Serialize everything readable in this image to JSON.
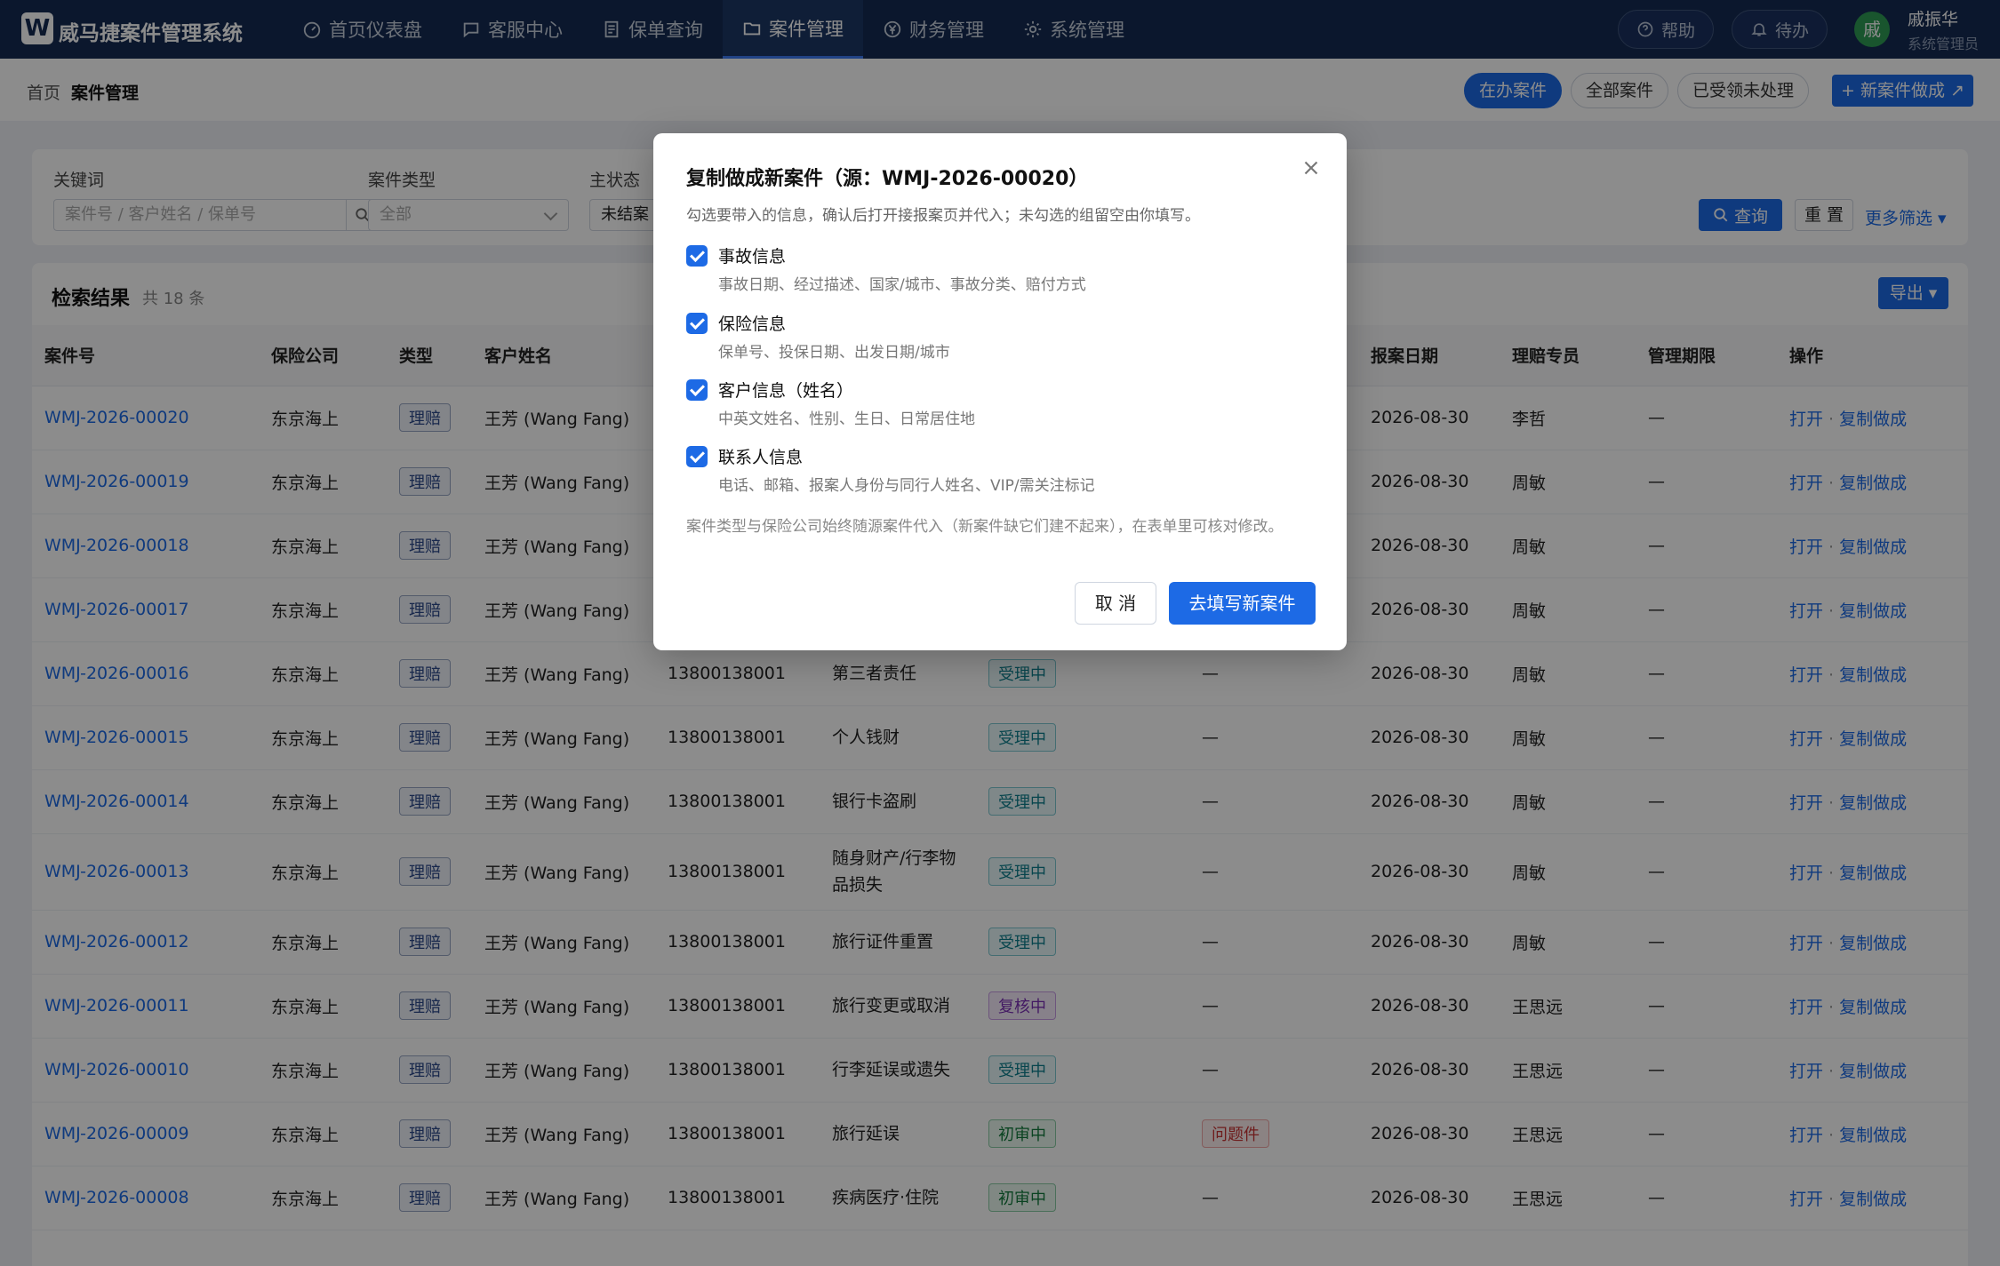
{
  "app": {
    "logo_letter": "W",
    "title": "威马捷案件管理系统"
  },
  "nav": [
    {
      "label": "首页仪表盘",
      "icon": "dashboard-icon"
    },
    {
      "label": "客服中心",
      "icon": "chat-icon"
    },
    {
      "label": "保单查询",
      "icon": "document-icon"
    },
    {
      "label": "案件管理",
      "icon": "folder-icon",
      "active": true
    },
    {
      "label": "财务管理",
      "icon": "yen-icon"
    },
    {
      "label": "系统管理",
      "icon": "gear-icon"
    }
  ],
  "top_right": {
    "help": "帮助",
    "todo": "待办",
    "avatar_char": "戚",
    "user_name": "戚振华",
    "user_role": "系统管理员"
  },
  "breadcrumb": {
    "home": "首页",
    "current": "案件管理"
  },
  "segments": [
    "在办案件",
    "全部案件",
    "已受领未处理"
  ],
  "new_case_label": "+ 新案件做成 ↗",
  "filter": {
    "keyword_label": "关键词",
    "keyword_placeholder": "案件号 / 客户姓名 / 保单号",
    "type_label": "案件类型",
    "type_value": "全部",
    "status_label": "主状态",
    "status_value": "未结案",
    "query": "查询",
    "reset": "重 置",
    "more": "更多筛选 ▾"
  },
  "results": {
    "title": "检索结果",
    "count": "共 18 条",
    "export": "导出 ▾",
    "columns": [
      "案件号",
      "保险公司",
      "类型",
      "客户姓名",
      "",
      "",
      "",
      "",
      "报案日期",
      "理赔专员",
      "管理期限",
      "操作"
    ],
    "op_open": "打开",
    "op_copy": "复制做成",
    "rows": [
      {
        "id": "WMJ-2026-00020",
        "company": "东京海上",
        "type": "理赔",
        "customer": "王芳 (Wang Fang)",
        "phone": "",
        "category": "",
        "status": "",
        "status_color": "",
        "issue": "",
        "date": "2026-08-30",
        "agent": "李哲",
        "deadline": "—"
      },
      {
        "id": "WMJ-2026-00019",
        "company": "东京海上",
        "type": "理赔",
        "customer": "王芳 (Wang Fang)",
        "phone": "",
        "category": "",
        "status": "",
        "status_color": "",
        "issue": "",
        "date": "2026-08-30",
        "agent": "周敏",
        "deadline": "—"
      },
      {
        "id": "WMJ-2026-00018",
        "company": "东京海上",
        "type": "理赔",
        "customer": "王芳 (Wang Fang)",
        "phone": "",
        "category": "",
        "status": "",
        "status_color": "",
        "issue": "",
        "date": "2026-08-30",
        "agent": "周敏",
        "deadline": "—"
      },
      {
        "id": "WMJ-2026-00017",
        "company": "东京海上",
        "type": "理赔",
        "customer": "王芳 (Wang Fang)",
        "phone": "",
        "category": "",
        "status": "",
        "status_color": "",
        "issue": "",
        "date": "2026-08-30",
        "agent": "周敏",
        "deadline": "—"
      },
      {
        "id": "WMJ-2026-00016",
        "company": "东京海上",
        "type": "理赔",
        "customer": "王芳 (Wang Fang)",
        "phone": "13800138001",
        "category": "第三者责任",
        "status": "受理中",
        "status_color": "cyan",
        "issue": "—",
        "date": "2026-08-30",
        "agent": "周敏",
        "deadline": "—"
      },
      {
        "id": "WMJ-2026-00015",
        "company": "东京海上",
        "type": "理赔",
        "customer": "王芳 (Wang Fang)",
        "phone": "13800138001",
        "category": "个人钱财",
        "status": "受理中",
        "status_color": "cyan",
        "issue": "—",
        "date": "2026-08-30",
        "agent": "周敏",
        "deadline": "—"
      },
      {
        "id": "WMJ-2026-00014",
        "company": "东京海上",
        "type": "理赔",
        "customer": "王芳 (Wang Fang)",
        "phone": "13800138001",
        "category": "银行卡盗刷",
        "status": "受理中",
        "status_color": "cyan",
        "issue": "—",
        "date": "2026-08-30",
        "agent": "周敏",
        "deadline": "—"
      },
      {
        "id": "WMJ-2026-00013",
        "company": "东京海上",
        "type": "理赔",
        "customer": "王芳 (Wang Fang)",
        "phone": "13800138001",
        "category": "随身财产/行李物品损失",
        "status": "受理中",
        "status_color": "cyan",
        "issue": "—",
        "date": "2026-08-30",
        "agent": "周敏",
        "deadline": "—"
      },
      {
        "id": "WMJ-2026-00012",
        "company": "东京海上",
        "type": "理赔",
        "customer": "王芳 (Wang Fang)",
        "phone": "13800138001",
        "category": "旅行证件重置",
        "status": "受理中",
        "status_color": "cyan",
        "issue": "—",
        "date": "2026-08-30",
        "agent": "周敏",
        "deadline": "—"
      },
      {
        "id": "WMJ-2026-00011",
        "company": "东京海上",
        "type": "理赔",
        "customer": "王芳 (Wang Fang)",
        "phone": "13800138001",
        "category": "旅行变更或取消",
        "status": "复核中",
        "status_color": "purple",
        "issue": "—",
        "date": "2026-08-30",
        "agent": "王思远",
        "deadline": "—"
      },
      {
        "id": "WMJ-2026-00010",
        "company": "东京海上",
        "type": "理赔",
        "customer": "王芳 (Wang Fang)",
        "phone": "13800138001",
        "category": "行李延误或遗失",
        "status": "受理中",
        "status_color": "cyan",
        "issue": "—",
        "date": "2026-08-30",
        "agent": "王思远",
        "deadline": "—"
      },
      {
        "id": "WMJ-2026-00009",
        "company": "东京海上",
        "type": "理赔",
        "customer": "王芳 (Wang Fang)",
        "phone": "13800138001",
        "category": "旅行延误",
        "status": "初审中",
        "status_color": "green",
        "issue": "问题件",
        "date": "2026-08-30",
        "agent": "王思远",
        "deadline": "—"
      },
      {
        "id": "WMJ-2026-00008",
        "company": "东京海上",
        "type": "理赔",
        "customer": "王芳 (Wang Fang)",
        "phone": "13800138001",
        "category": "疾病医疗·住院",
        "status": "初审中",
        "status_color": "green",
        "issue": "—",
        "date": "2026-08-30",
        "agent": "王思远",
        "deadline": "—"
      }
    ]
  },
  "modal": {
    "title": "复制做成新案件（源：WMJ-2026-00020）",
    "desc": "勾选要带入的信息，确认后打开接报案页并代入；未勾选的组留空由你填写。",
    "options": [
      {
        "title": "事故信息",
        "sub": "事故日期、经过描述、国家/城市、事故分类、赔付方式",
        "checked": true
      },
      {
        "title": "保险信息",
        "sub": "保单号、投保日期、出发日期/城市",
        "checked": true
      },
      {
        "title": "客户信息（姓名）",
        "sub": "中英文姓名、性别、生日、日常居住地",
        "checked": true
      },
      {
        "title": "联系人信息",
        "sub": "电话、邮箱、报案人身份与同行人姓名、VIP/需关注标记",
        "checked": true
      }
    ],
    "note": "案件类型与保险公司始终随源案件代入（新案件缺它们建不起来），在表单里可核对修改。",
    "cancel": "取 消",
    "confirm": "去填写新案件"
  }
}
